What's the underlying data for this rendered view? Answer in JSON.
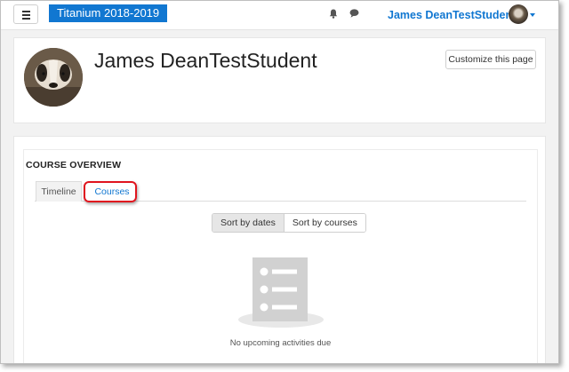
{
  "navbar": {
    "brand": "Titanium 2018-2019",
    "user_name": "James DeanTestStudent",
    "menu_icon": "hamburger-icon",
    "notifications_icon": "bell-icon",
    "messages_icon": "chat-bubble-icon"
  },
  "header": {
    "title": "James DeanTestStudent",
    "customize_label": "Customize this page"
  },
  "course_overview": {
    "title": "COURSE OVERVIEW",
    "tabs": [
      {
        "label": "Timeline",
        "active": true
      },
      {
        "label": "Courses",
        "active": false,
        "highlighted": true
      }
    ],
    "sort": {
      "by_dates_label": "Sort by dates",
      "by_courses_label": "Sort by courses",
      "selected": "Sort by dates"
    },
    "empty_icon": "empty-list-icon",
    "empty_message": "No upcoming activities due"
  },
  "colors": {
    "brand": "#1177d1",
    "highlight": "#e0141e"
  }
}
